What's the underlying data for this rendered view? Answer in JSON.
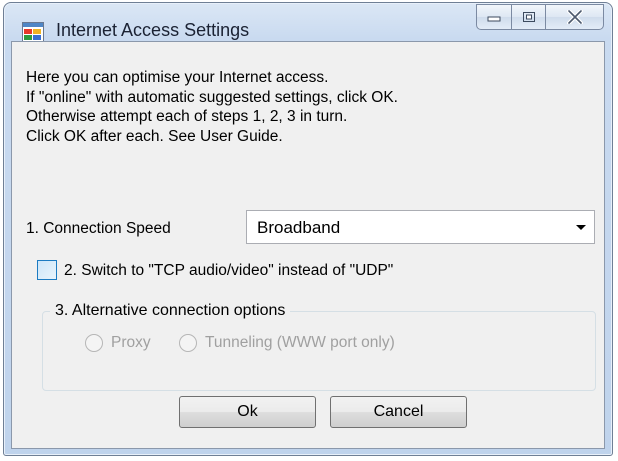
{
  "window": {
    "title": "Internet Access Settings",
    "icon": "app-window-icon",
    "controls": [
      "minimize-icon",
      "maximize-icon",
      "close-icon"
    ]
  },
  "intro": {
    "lines": [
      "Here you can optimise your Internet access.",
      "If \"online\" with automatic suggested settings, click OK.",
      "Otherwise attempt each of steps 1, 2, 3 in turn.",
      "Click OK after each.  See User Guide."
    ]
  },
  "connection_speed": {
    "label": "1. Connection Speed",
    "selected": "Broadband"
  },
  "tcp_switch": {
    "label": "2. Switch to \"TCP audio/video\"  instead of \"UDP\"",
    "checked": false
  },
  "alternative": {
    "title": "3. Alternative connection options",
    "options": [
      {
        "label": "Proxy",
        "selected": false,
        "enabled": false
      },
      {
        "label": "Tunneling (WWW port only)",
        "selected": false,
        "enabled": false
      }
    ]
  },
  "buttons": {
    "ok_label": "Ok",
    "cancel_label": "Cancel"
  },
  "colors": {
    "checkbox_border": "#1c7bc2",
    "disabled_text": "#a0a0a0"
  }
}
